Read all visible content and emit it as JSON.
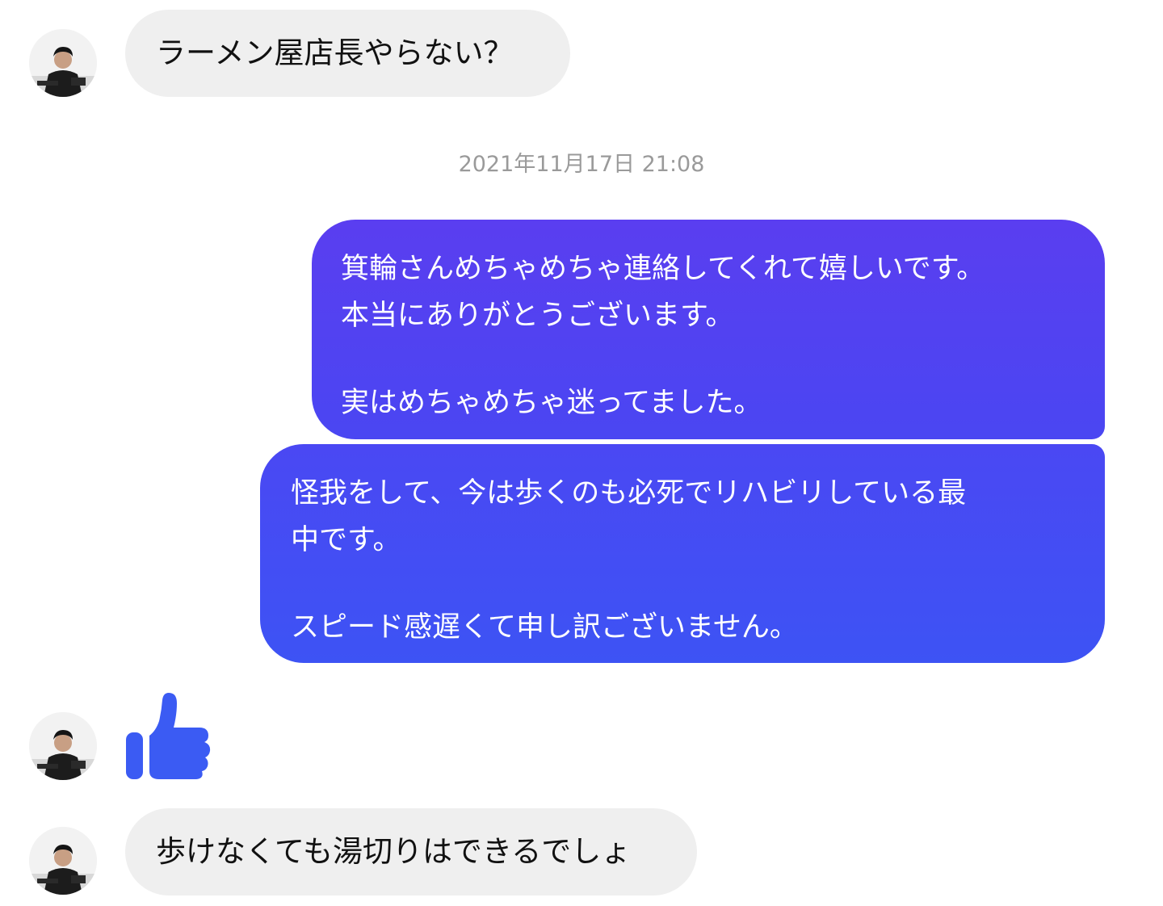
{
  "conversation": {
    "messages": [
      {
        "direction": "incoming",
        "text": "ラーメン屋店長やらない？"
      },
      {
        "direction": "incoming",
        "text": "歩けなくても湯切りはできるでしょ"
      }
    ],
    "timestamp": "2021年11月17日 21:08",
    "outgoing": {
      "first": {
        "line1": "箕輪さんめちゃめちゃ連絡してくれて嬉しいです。",
        "line2": "本当にありがとうございます。",
        "line3": "実はめちゃめちゃ迷ってました。"
      },
      "second": {
        "line1": "怪我をして、今は歩くのも必死でリハビリしている最",
        "line2": "中です。",
        "line3": "スピード感遅くて申し訳ございません。"
      }
    },
    "reaction": {
      "icon": "thumbs-up-icon",
      "color": "#3b5bf3"
    },
    "colors": {
      "incoming_bubble": "#efefef",
      "outgoing_gradient_top": "#5a3ef0",
      "outgoing_gradient_bottom": "#3d53f4",
      "timestamp_text": "#9a9a9a"
    }
  }
}
